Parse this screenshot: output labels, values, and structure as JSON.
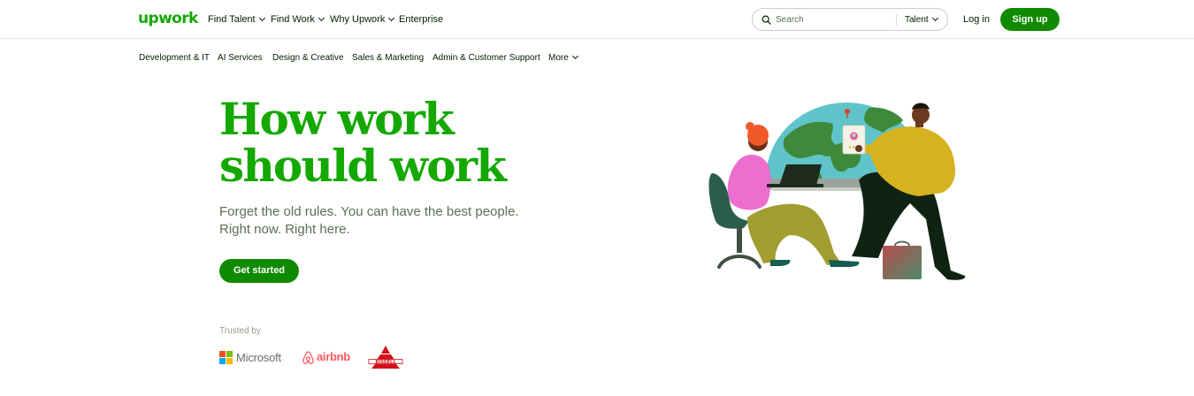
{
  "header": {
    "logo_text": "upwork",
    "nav": [
      {
        "label": "Find Talent",
        "has_dropdown": true
      },
      {
        "label": "Find Work",
        "has_dropdown": true
      },
      {
        "label": "Why Upwork",
        "has_dropdown": true
      },
      {
        "label": "Enterprise",
        "has_dropdown": false
      }
    ],
    "search": {
      "placeholder": "Search",
      "type_label": "Talent"
    },
    "login_label": "Log in",
    "signup_label": "Sign up"
  },
  "categories": [
    "Development & IT",
    "AI Services",
    "Design & Creative",
    "Sales & Marketing",
    "Admin & Customer Support",
    "More"
  ],
  "hero": {
    "title_line1": "How work",
    "title_line2": "should work",
    "subtitle_line1": "Forget the old rules. You can have the best people.",
    "subtitle_line2": "Right now. Right here.",
    "cta_label": "Get started"
  },
  "trusted": {
    "label": "Trusted by",
    "logos": [
      {
        "name": "Microsoft",
        "text": "Microsoft"
      },
      {
        "name": "Airbnb",
        "text": "airbnb"
      },
      {
        "name": "Bissell",
        "text": "BISSELL"
      }
    ]
  },
  "colors": {
    "brand_green": "#14a800",
    "button_green": "#108a00",
    "text_dark": "#001e00",
    "text_muted": "#5e6d55",
    "airbnb_red": "#ff5a5f",
    "bissell_red": "#d2111a"
  },
  "icons": [
    "search-icon",
    "chevron-down-icon",
    "microsoft-logo-icon",
    "airbnb-logo-icon",
    "bissell-logo-icon"
  ]
}
